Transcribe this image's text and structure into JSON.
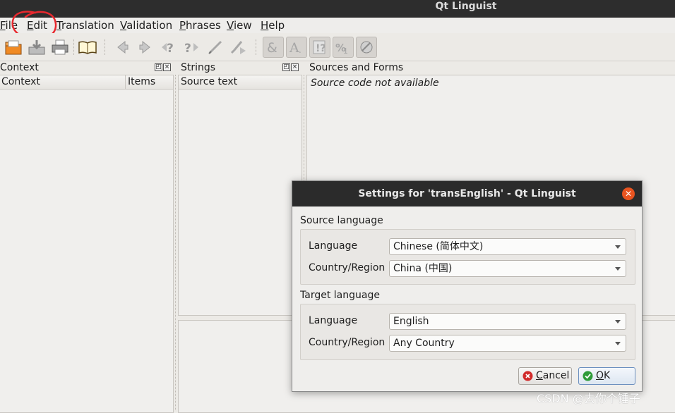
{
  "window": {
    "title": "Qt Linguist"
  },
  "menu": [
    {
      "label": "File",
      "mnemonic": "F",
      "rest": "ile"
    },
    {
      "label": "Edit",
      "mnemonic": "E",
      "rest": "dit"
    },
    {
      "label": "Translation",
      "mnemonic": "T",
      "rest": "ranslation"
    },
    {
      "label": "Validation",
      "mnemonic": "V",
      "rest": "alidation"
    },
    {
      "label": "Phrases",
      "mnemonic": "P",
      "rest": "hrases"
    },
    {
      "label": "View",
      "mnemonic": "V",
      "rest": "iew"
    },
    {
      "label": "Help",
      "mnemonic": "H",
      "rest": "elp"
    }
  ],
  "toolbar_icons": [
    "open-icon",
    "save-icon",
    "print-icon",
    "phrase-book-icon",
    "previous-icon",
    "next-icon",
    "prev-unfinished-icon",
    "next-unfinished-icon",
    "done-icon",
    "done-and-next-icon",
    "accelerators-icon",
    "punctuation-icon",
    "phrase-matches-icon",
    "place-markers-icon",
    "surrounding-whitespace-icon"
  ],
  "panes": {
    "context": {
      "title": "Context",
      "columns": [
        "Context",
        "Items"
      ]
    },
    "strings": {
      "title": "Strings",
      "columns": [
        "Source text"
      ]
    },
    "sources": {
      "title": "Sources and Forms",
      "message": "Source code not available"
    }
  },
  "dialog": {
    "title": "Settings for 'transEnglish' - Qt Linguist",
    "source_group": {
      "label": "Source language",
      "language_label": "Language",
      "language_value": "Chinese (简体中文)",
      "country_label": "Country/Region",
      "country_value": "China (中国)"
    },
    "target_group": {
      "label": "Target language",
      "language_label": "Language",
      "language_value": "English",
      "country_label": "Country/Region",
      "country_value": "Any Country"
    },
    "cancel": {
      "mnemonic": "C",
      "rest": "ancel"
    },
    "ok": {
      "mnemonic": "O",
      "rest": "K"
    }
  },
  "watermark": "CSDN @去你个锤子",
  "colors": {
    "accent_close": "#e95420",
    "annotation": "#e8282e",
    "titlebar": "#2b2b2b"
  }
}
